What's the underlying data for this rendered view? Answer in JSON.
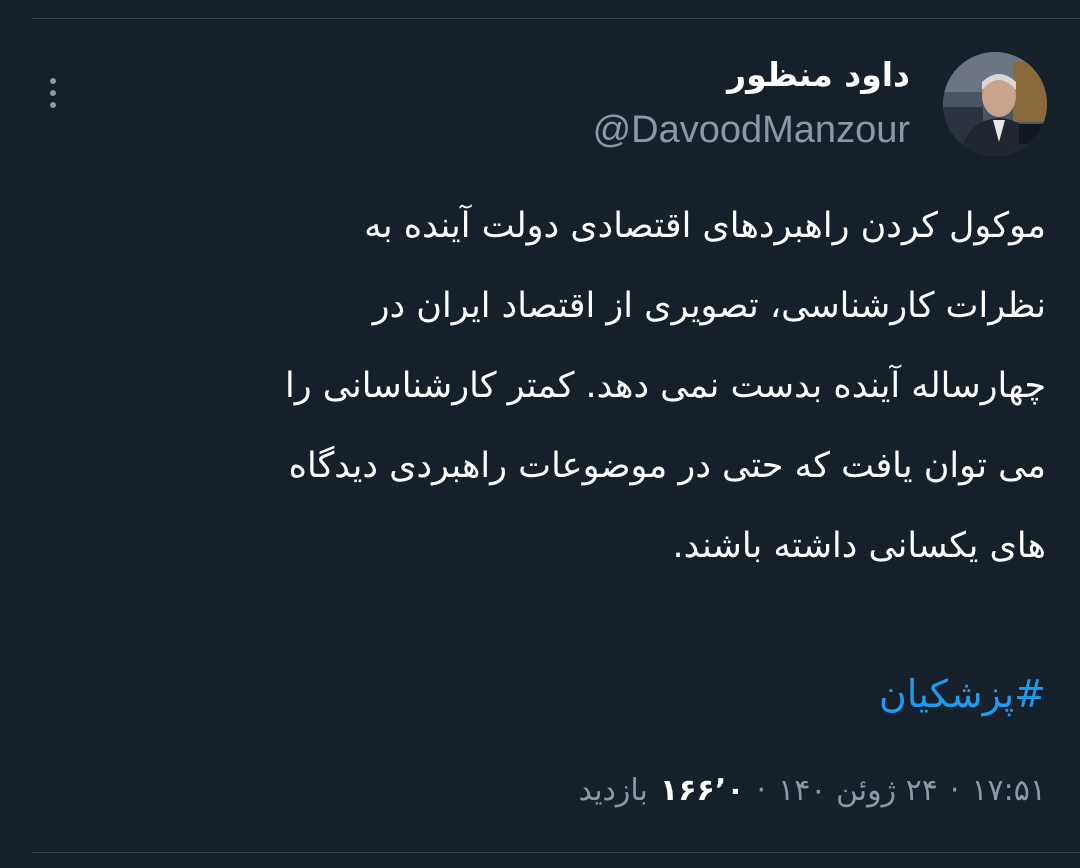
{
  "tweet": {
    "author": {
      "display_name": "داود منظور",
      "handle": "@DavoodManzour",
      "avatar_icon": "profile-photo"
    },
    "text_lines": [
      "موکول کردن راهبردهای اقتصادی دولت آینده به",
      "نظرات کارشناسی، تصویری از اقتصاد ایران در",
      "چهارساله آینده بدست نمی دهد. کمتر  کارشناسانی را",
      "می توان یافت که حتی در موضوعات راهبردی دیدگاه",
      "های یکسانی داشته باشند."
    ],
    "hashtag": "#پزشکیان",
    "time": "۱۷:۵۱",
    "separator": "·",
    "date": "۲۴ ژوئن ۱۴۰",
    "views_count": "۱۶۶٬۰",
    "views_label": "بازدید"
  },
  "icons": {
    "more": "more-vertical-icon"
  },
  "colors": {
    "background": "#15202b",
    "text_primary": "#ffffff",
    "text_secondary": "#8b98a5",
    "link": "#1d9bf0",
    "divider": "#38444d"
  }
}
